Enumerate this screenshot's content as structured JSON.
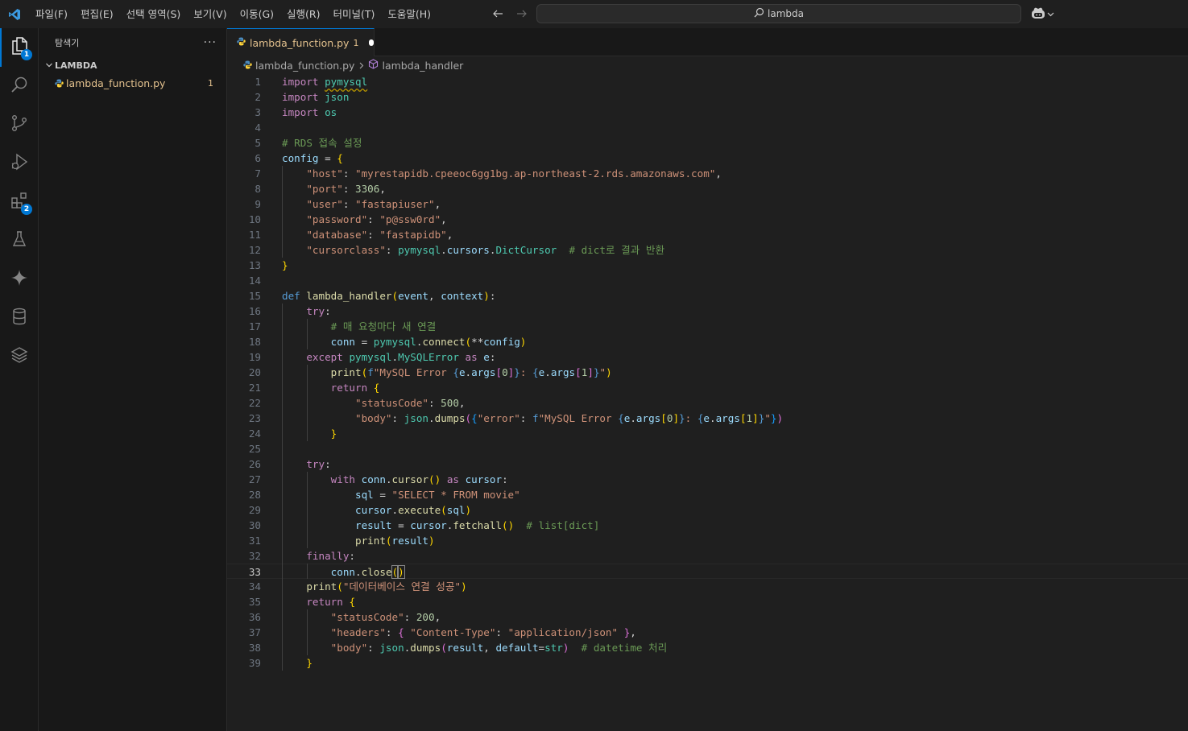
{
  "menu": [
    "파일(F)",
    "편집(E)",
    "선택 영역(S)",
    "보기(V)",
    "이동(G)",
    "실행(R)",
    "터미널(T)",
    "도움말(H)"
  ],
  "search": {
    "text": "lambda"
  },
  "activity_bar": {
    "explorer_badge": "1",
    "extensions_badge": "2"
  },
  "sidebar": {
    "title": "탐색기",
    "more": "···",
    "folder": "LAMBDA",
    "file": {
      "name": "lambda_function.py",
      "badge": "1"
    }
  },
  "tab": {
    "label": "lambda_function.py",
    "badge": "1"
  },
  "breadcrumb": {
    "file": "lambda_function.py",
    "symbol": "lambda_handler"
  },
  "editor": {
    "current_line": "33",
    "lines": [
      [
        {
          "t": "import",
          "c": "k"
        },
        {
          "t": " ",
          "c": "w"
        },
        {
          "t": "pymysql",
          "c": "m sq"
        }
      ],
      [
        {
          "t": "import",
          "c": "k"
        },
        {
          "t": " ",
          "c": "w"
        },
        {
          "t": "json",
          "c": "m"
        }
      ],
      [
        {
          "t": "import",
          "c": "k"
        },
        {
          "t": " ",
          "c": "w"
        },
        {
          "t": "os",
          "c": "m"
        }
      ],
      [],
      [
        {
          "t": "# RDS 접속 설정",
          "c": "c"
        }
      ],
      [
        {
          "t": "config",
          "c": "v"
        },
        {
          "t": " = ",
          "c": "w"
        },
        {
          "t": "{",
          "c": "p1"
        }
      ],
      [
        {
          "t": "    ",
          "c": "w"
        },
        {
          "t": "\"host\"",
          "c": "s"
        },
        {
          "t": ": ",
          "c": "w"
        },
        {
          "t": "\"myrestapidb.cpeeoc6gg1bg.ap-northeast-2.rds.amazonaws.com\"",
          "c": "s"
        },
        {
          "t": ",",
          "c": "w"
        }
      ],
      [
        {
          "t": "    ",
          "c": "w"
        },
        {
          "t": "\"port\"",
          "c": "s"
        },
        {
          "t": ": ",
          "c": "w"
        },
        {
          "t": "3306",
          "c": "n"
        },
        {
          "t": ",",
          "c": "w"
        }
      ],
      [
        {
          "t": "    ",
          "c": "w"
        },
        {
          "t": "\"user\"",
          "c": "s"
        },
        {
          "t": ": ",
          "c": "w"
        },
        {
          "t": "\"fastapiuser\"",
          "c": "s"
        },
        {
          "t": ",",
          "c": "w"
        }
      ],
      [
        {
          "t": "    ",
          "c": "w"
        },
        {
          "t": "\"password\"",
          "c": "s"
        },
        {
          "t": ": ",
          "c": "w"
        },
        {
          "t": "\"p@ssw0rd\"",
          "c": "s"
        },
        {
          "t": ",",
          "c": "w"
        }
      ],
      [
        {
          "t": "    ",
          "c": "w"
        },
        {
          "t": "\"database\"",
          "c": "s"
        },
        {
          "t": ": ",
          "c": "w"
        },
        {
          "t": "\"fastapidb\"",
          "c": "s"
        },
        {
          "t": ",",
          "c": "w"
        }
      ],
      [
        {
          "t": "    ",
          "c": "w"
        },
        {
          "t": "\"cursorclass\"",
          "c": "s"
        },
        {
          "t": ": ",
          "c": "w"
        },
        {
          "t": "pymysql",
          "c": "m"
        },
        {
          "t": ".",
          "c": "w"
        },
        {
          "t": "cursors",
          "c": "v"
        },
        {
          "t": ".",
          "c": "w"
        },
        {
          "t": "DictCursor",
          "c": "m"
        },
        {
          "t": "  ",
          "c": "w"
        },
        {
          "t": "# dict로 결과 반환",
          "c": "c"
        }
      ],
      [
        {
          "t": "}",
          "c": "p1"
        }
      ],
      [],
      [
        {
          "t": "def",
          "c": "kd"
        },
        {
          "t": " ",
          "c": "w"
        },
        {
          "t": "lambda_handler",
          "c": "f"
        },
        {
          "t": "(",
          "c": "p1"
        },
        {
          "t": "event",
          "c": "v"
        },
        {
          "t": ", ",
          "c": "w"
        },
        {
          "t": "context",
          "c": "v"
        },
        {
          "t": ")",
          "c": "p1"
        },
        {
          "t": ":",
          "c": "w"
        }
      ],
      [
        {
          "t": "    ",
          "c": "w"
        },
        {
          "t": "try",
          "c": "k"
        },
        {
          "t": ":",
          "c": "w"
        }
      ],
      [
        {
          "t": "        ",
          "c": "w"
        },
        {
          "t": "# 매 요청마다 새 연결",
          "c": "c"
        }
      ],
      [
        {
          "t": "        ",
          "c": "w"
        },
        {
          "t": "conn",
          "c": "v"
        },
        {
          "t": " = ",
          "c": "w"
        },
        {
          "t": "pymysql",
          "c": "m"
        },
        {
          "t": ".",
          "c": "w"
        },
        {
          "t": "connect",
          "c": "f"
        },
        {
          "t": "(",
          "c": "p1"
        },
        {
          "t": "**",
          "c": "w"
        },
        {
          "t": "config",
          "c": "v"
        },
        {
          "t": ")",
          "c": "p1"
        }
      ],
      [
        {
          "t": "    ",
          "c": "w"
        },
        {
          "t": "except",
          "c": "k"
        },
        {
          "t": " ",
          "c": "w"
        },
        {
          "t": "pymysql",
          "c": "m"
        },
        {
          "t": ".",
          "c": "w"
        },
        {
          "t": "MySQLError",
          "c": "m"
        },
        {
          "t": " ",
          "c": "w"
        },
        {
          "t": "as",
          "c": "k"
        },
        {
          "t": " ",
          "c": "w"
        },
        {
          "t": "e",
          "c": "v"
        },
        {
          "t": ":",
          "c": "w"
        }
      ],
      [
        {
          "t": "        ",
          "c": "w"
        },
        {
          "t": "print",
          "c": "f"
        },
        {
          "t": "(",
          "c": "p1"
        },
        {
          "t": "f",
          "c": "p"
        },
        {
          "t": "\"MySQL Error ",
          "c": "s"
        },
        {
          "t": "{",
          "c": "p"
        },
        {
          "t": "e",
          "c": "v"
        },
        {
          "t": ".",
          "c": "w"
        },
        {
          "t": "args",
          "c": "v"
        },
        {
          "t": "[",
          "c": "p2"
        },
        {
          "t": "0",
          "c": "n"
        },
        {
          "t": "]",
          "c": "p2"
        },
        {
          "t": "}",
          "c": "p"
        },
        {
          "t": ": ",
          "c": "s"
        },
        {
          "t": "{",
          "c": "p"
        },
        {
          "t": "e",
          "c": "v"
        },
        {
          "t": ".",
          "c": "w"
        },
        {
          "t": "args",
          "c": "v"
        },
        {
          "t": "[",
          "c": "p2"
        },
        {
          "t": "1",
          "c": "n"
        },
        {
          "t": "]",
          "c": "p2"
        },
        {
          "t": "}",
          "c": "p"
        },
        {
          "t": "\"",
          "c": "s"
        },
        {
          "t": ")",
          "c": "p1"
        }
      ],
      [
        {
          "t": "        ",
          "c": "w"
        },
        {
          "t": "return",
          "c": "k"
        },
        {
          "t": " ",
          "c": "w"
        },
        {
          "t": "{",
          "c": "p1"
        }
      ],
      [
        {
          "t": "            ",
          "c": "w"
        },
        {
          "t": "\"statusCode\"",
          "c": "s"
        },
        {
          "t": ": ",
          "c": "w"
        },
        {
          "t": "500",
          "c": "n"
        },
        {
          "t": ",",
          "c": "w"
        }
      ],
      [
        {
          "t": "            ",
          "c": "w"
        },
        {
          "t": "\"body\"",
          "c": "s"
        },
        {
          "t": ": ",
          "c": "w"
        },
        {
          "t": "json",
          "c": "m"
        },
        {
          "t": ".",
          "c": "w"
        },
        {
          "t": "dumps",
          "c": "f"
        },
        {
          "t": "(",
          "c": "p2"
        },
        {
          "t": "{",
          "c": "p3"
        },
        {
          "t": "\"error\"",
          "c": "s"
        },
        {
          "t": ": ",
          "c": "w"
        },
        {
          "t": "f",
          "c": "p"
        },
        {
          "t": "\"MySQL Error ",
          "c": "s"
        },
        {
          "t": "{",
          "c": "p"
        },
        {
          "t": "e",
          "c": "v"
        },
        {
          "t": ".",
          "c": "w"
        },
        {
          "t": "args",
          "c": "v"
        },
        {
          "t": "[",
          "c": "p1"
        },
        {
          "t": "0",
          "c": "n"
        },
        {
          "t": "]",
          "c": "p1"
        },
        {
          "t": "}",
          "c": "p"
        },
        {
          "t": ": ",
          "c": "s"
        },
        {
          "t": "{",
          "c": "p"
        },
        {
          "t": "e",
          "c": "v"
        },
        {
          "t": ".",
          "c": "w"
        },
        {
          "t": "args",
          "c": "v"
        },
        {
          "t": "[",
          "c": "p1"
        },
        {
          "t": "1",
          "c": "n"
        },
        {
          "t": "]",
          "c": "p1"
        },
        {
          "t": "}",
          "c": "p"
        },
        {
          "t": "\"",
          "c": "s"
        },
        {
          "t": "}",
          "c": "p3"
        },
        {
          "t": ")",
          "c": "p2"
        }
      ],
      [
        {
          "t": "        ",
          "c": "w"
        },
        {
          "t": "}",
          "c": "p1"
        }
      ],
      [],
      [
        {
          "t": "    ",
          "c": "w"
        },
        {
          "t": "try",
          "c": "k"
        },
        {
          "t": ":",
          "c": "w"
        }
      ],
      [
        {
          "t": "        ",
          "c": "w"
        },
        {
          "t": "with",
          "c": "k"
        },
        {
          "t": " ",
          "c": "w"
        },
        {
          "t": "conn",
          "c": "v"
        },
        {
          "t": ".",
          "c": "w"
        },
        {
          "t": "cursor",
          "c": "f"
        },
        {
          "t": "()",
          "c": "p1"
        },
        {
          "t": " ",
          "c": "w"
        },
        {
          "t": "as",
          "c": "k"
        },
        {
          "t": " ",
          "c": "w"
        },
        {
          "t": "cursor",
          "c": "v"
        },
        {
          "t": ":",
          "c": "w"
        }
      ],
      [
        {
          "t": "            ",
          "c": "w"
        },
        {
          "t": "sql",
          "c": "v"
        },
        {
          "t": " = ",
          "c": "w"
        },
        {
          "t": "\"SELECT * FROM movie\"",
          "c": "s"
        }
      ],
      [
        {
          "t": "            ",
          "c": "w"
        },
        {
          "t": "cursor",
          "c": "v"
        },
        {
          "t": ".",
          "c": "w"
        },
        {
          "t": "execute",
          "c": "f"
        },
        {
          "t": "(",
          "c": "p1"
        },
        {
          "t": "sql",
          "c": "v"
        },
        {
          "t": ")",
          "c": "p1"
        }
      ],
      [
        {
          "t": "            ",
          "c": "w"
        },
        {
          "t": "result",
          "c": "v"
        },
        {
          "t": " = ",
          "c": "w"
        },
        {
          "t": "cursor",
          "c": "v"
        },
        {
          "t": ".",
          "c": "w"
        },
        {
          "t": "fetchall",
          "c": "f"
        },
        {
          "t": "()",
          "c": "p1"
        },
        {
          "t": "  ",
          "c": "w"
        },
        {
          "t": "# list[dict]",
          "c": "c"
        }
      ],
      [
        {
          "t": "            ",
          "c": "w"
        },
        {
          "t": "print",
          "c": "f"
        },
        {
          "t": "(",
          "c": "p1"
        },
        {
          "t": "result",
          "c": "v"
        },
        {
          "t": ")",
          "c": "p1"
        }
      ],
      [
        {
          "t": "    ",
          "c": "w"
        },
        {
          "t": "finally",
          "c": "k"
        },
        {
          "t": ":",
          "c": "w"
        }
      ],
      [
        {
          "t": "        ",
          "c": "w"
        },
        {
          "t": "conn",
          "c": "v"
        },
        {
          "t": ".",
          "c": "w"
        },
        {
          "t": "close",
          "c": "f"
        },
        {
          "t": "(",
          "c": "p1 bm"
        },
        {
          "t": ")",
          "c": "p1 bm"
        }
      ],
      [
        {
          "t": "    ",
          "c": "w"
        },
        {
          "t": "print",
          "c": "f"
        },
        {
          "t": "(",
          "c": "p1"
        },
        {
          "t": "\"데이터베이스 연결 성공\"",
          "c": "s"
        },
        {
          "t": ")",
          "c": "p1"
        }
      ],
      [
        {
          "t": "    ",
          "c": "w"
        },
        {
          "t": "return",
          "c": "k"
        },
        {
          "t": " ",
          "c": "w"
        },
        {
          "t": "{",
          "c": "p1"
        }
      ],
      [
        {
          "t": "        ",
          "c": "w"
        },
        {
          "t": "\"statusCode\"",
          "c": "s"
        },
        {
          "t": ": ",
          "c": "w"
        },
        {
          "t": "200",
          "c": "n"
        },
        {
          "t": ",",
          "c": "w"
        }
      ],
      [
        {
          "t": "        ",
          "c": "w"
        },
        {
          "t": "\"headers\"",
          "c": "s"
        },
        {
          "t": ": ",
          "c": "w"
        },
        {
          "t": "{",
          "c": "p2"
        },
        {
          "t": " ",
          "c": "w"
        },
        {
          "t": "\"Content-Type\"",
          "c": "s"
        },
        {
          "t": ": ",
          "c": "w"
        },
        {
          "t": "\"application/json\"",
          "c": "s"
        },
        {
          "t": " ",
          "c": "w"
        },
        {
          "t": "}",
          "c": "p2"
        },
        {
          "t": ",",
          "c": "w"
        }
      ],
      [
        {
          "t": "        ",
          "c": "w"
        },
        {
          "t": "\"body\"",
          "c": "s"
        },
        {
          "t": ": ",
          "c": "w"
        },
        {
          "t": "json",
          "c": "m"
        },
        {
          "t": ".",
          "c": "w"
        },
        {
          "t": "dumps",
          "c": "f"
        },
        {
          "t": "(",
          "c": "p2"
        },
        {
          "t": "result",
          "c": "v"
        },
        {
          "t": ", ",
          "c": "w"
        },
        {
          "t": "default",
          "c": "v"
        },
        {
          "t": "=",
          "c": "w"
        },
        {
          "t": "str",
          "c": "m"
        },
        {
          "t": ")",
          "c": "p2"
        },
        {
          "t": "  ",
          "c": "w"
        },
        {
          "t": "# datetime 처리",
          "c": "c"
        }
      ],
      [
        {
          "t": "    ",
          "c": "w"
        },
        {
          "t": "}",
          "c": "p1"
        }
      ]
    ]
  }
}
